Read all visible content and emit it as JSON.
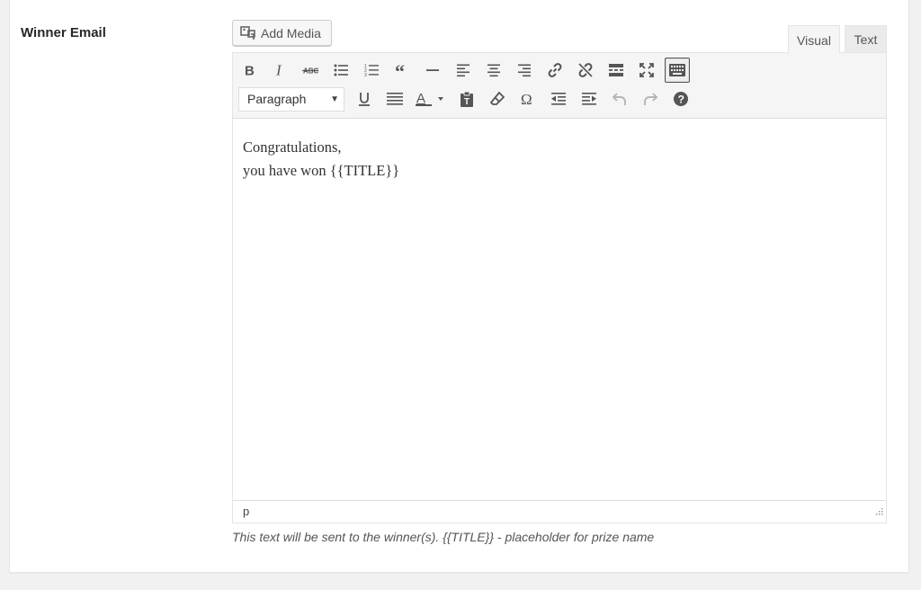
{
  "field": {
    "label": "Winner Email"
  },
  "media": {
    "add_media_label": "Add Media",
    "icon": "media-icon"
  },
  "tabs": [
    {
      "label": "Visual",
      "active": true
    },
    {
      "label": "Text",
      "active": false
    }
  ],
  "toolbar": {
    "row1": [
      "bold-icon",
      "italic-icon",
      "strikethrough-icon",
      "bulleted-list-icon",
      "numbered-list-icon",
      "blockquote-icon",
      "horizontal-line-icon",
      "align-left-icon",
      "align-center-icon",
      "align-right-icon",
      "insert-link-icon",
      "remove-link-icon",
      "read-more-icon",
      "fullscreen-icon",
      "toolbar-toggle-icon"
    ],
    "format_select": {
      "value": "Paragraph"
    },
    "row2": [
      "underline-icon",
      "justify-icon",
      "text-color-icon",
      "paste-as-text-icon",
      "clear-formatting-icon",
      "special-character-icon",
      "decrease-indent-icon",
      "increase-indent-icon",
      "undo-icon",
      "redo-icon",
      "help-icon"
    ]
  },
  "editor": {
    "content_lines": [
      "Congratulations,",
      "you have won {{TITLE}}"
    ],
    "path": "p"
  },
  "help_text": "This text will be sent to the winner(s). {{TITLE}} - placeholder for prize name",
  "colors": {
    "page_bg": "#f1f1f1",
    "panel_bg": "#ffffff",
    "toolbar_bg": "#f5f5f5",
    "icon": "#555555"
  }
}
